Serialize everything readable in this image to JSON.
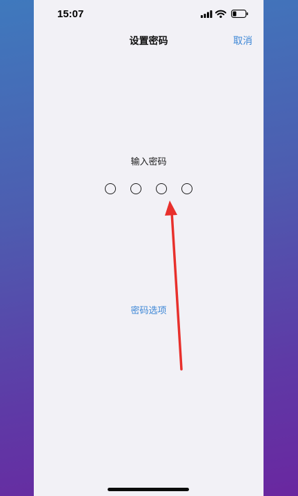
{
  "status_bar": {
    "time": "15:07",
    "signal_icon": "signal-bars-icon",
    "wifi_icon": "wifi-icon",
    "battery_icon": "battery-low-icon"
  },
  "nav": {
    "title": "设置密码",
    "cancel_label": "取消"
  },
  "prompt": "输入密码",
  "passcode": {
    "digit_count": 4,
    "filled": 0
  },
  "options_label": "密码选项",
  "colors": {
    "accent": "#3d87d6",
    "annotation_arrow": "#e8302c",
    "screen_bg": "#f2f1f6"
  }
}
